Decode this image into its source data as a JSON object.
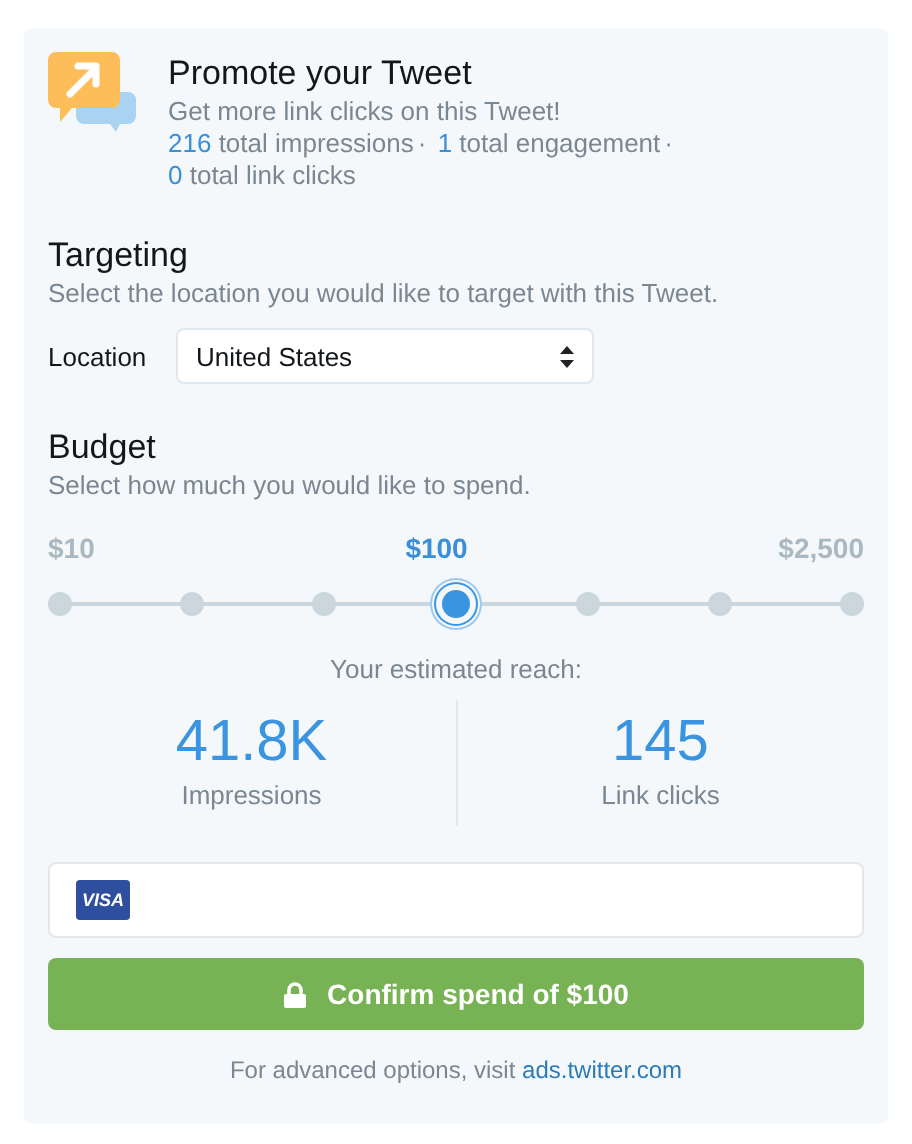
{
  "header": {
    "title": "Promote your Tweet",
    "subtitle": "Get more link clicks on this Tweet!",
    "separator": "·",
    "stats": [
      {
        "count": "216",
        "metric": "total impressions"
      },
      {
        "count": "1",
        "metric": "total engagement"
      },
      {
        "count": "0",
        "metric": "total link clicks"
      }
    ]
  },
  "targeting": {
    "heading": "Targeting",
    "description": "Select the location you would like to target with this Tweet.",
    "field_label": "Location",
    "location": "United States"
  },
  "budget": {
    "heading": "Budget",
    "description": "Select how much you would like to spend.",
    "price_labels": [
      {
        "text": "$10",
        "selected": false
      },
      {
        "text": "$100",
        "selected": true
      },
      {
        "text": "$2,500",
        "selected": false
      }
    ],
    "stops": [
      {
        "selected": false
      },
      {
        "selected": false
      },
      {
        "selected": false
      },
      {
        "selected": true
      },
      {
        "selected": false
      },
      {
        "selected": false
      },
      {
        "selected": false
      }
    ]
  },
  "reach": {
    "title": "Your estimated reach:",
    "metrics": [
      {
        "value": "41.8K",
        "label": "Impressions"
      },
      {
        "value": "145",
        "label": "Link clicks"
      }
    ]
  },
  "payment": {
    "card_brand": "VISA"
  },
  "confirm_button": "Confirm spend of $100",
  "footer": {
    "text": "For advanced options, visit",
    "link": "ads.twitter.com"
  }
}
